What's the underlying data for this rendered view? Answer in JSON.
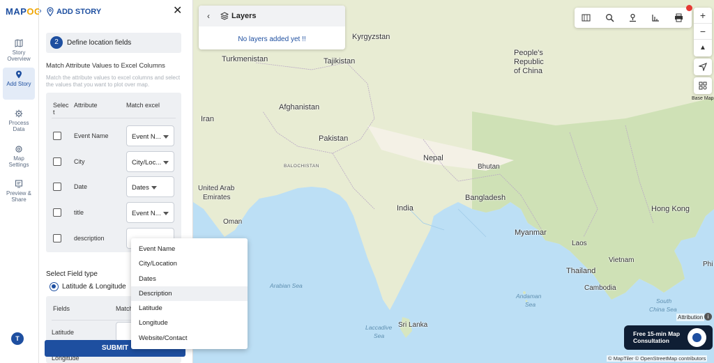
{
  "brand": {
    "logo_text_1": "MAP",
    "logo_text_2": "OG"
  },
  "rail": {
    "items": [
      {
        "label": "Story Overview"
      },
      {
        "label": "Add Story"
      },
      {
        "label": "Process Data"
      },
      {
        "label": "Map Settings"
      },
      {
        "label": "Preview & Share"
      }
    ],
    "avatar_letter": "T"
  },
  "panel": {
    "title": "ADD STORY",
    "step_number": "2",
    "step_label": "Define location fields",
    "match_title": "Match Attribute Values to Excel Columns",
    "match_desc": "Match the attribute values to excel columns and select the values that you want to plot over map.",
    "headers": {
      "select_1": "Selec",
      "select_2": "t",
      "attribute": "Attribute",
      "match": "Match excel"
    },
    "rows": [
      {
        "attribute": "Event Name",
        "value": "Event N..."
      },
      {
        "attribute": "City",
        "value": "City/Loc..."
      },
      {
        "attribute": "Date",
        "value": "Dates"
      },
      {
        "attribute": "title",
        "value": "Event N..."
      },
      {
        "attribute": "description",
        "value": ""
      }
    ],
    "field_type_label": "Select Field type",
    "field_type_option": "Latitude & Longitude",
    "fields_header": "Fields",
    "fields_match_header": "Match",
    "field_rows": [
      "Latitude",
      "Longitude"
    ],
    "submit_label": "SUBMIT"
  },
  "dropdown": {
    "options": [
      "Event Name",
      "City/Location",
      "Dates",
      "Description",
      "Latitude",
      "Longitude",
      "Website/Contact"
    ],
    "highlighted": "Description"
  },
  "layers": {
    "title": "Layers",
    "empty_message": "No layers added yet !!"
  },
  "map": {
    "places": [
      {
        "name": "Kyrgyzstan",
        "kind": "country"
      },
      {
        "name": "Tajikistan",
        "kind": "country"
      },
      {
        "name": "Turkmenistan",
        "kind": "country"
      },
      {
        "name": "People's",
        "kind": "country"
      },
      {
        "name": "Republic",
        "kind": "country"
      },
      {
        "name": "of China",
        "kind": "country"
      },
      {
        "name": "Afghanistan",
        "kind": "country"
      },
      {
        "name": "Iran",
        "kind": "country"
      },
      {
        "name": "Pakistan",
        "kind": "country"
      },
      {
        "name": "BALOCHISTAN",
        "kind": "region"
      },
      {
        "name": "Nepal",
        "kind": "country"
      },
      {
        "name": "Bhutan",
        "kind": "country"
      },
      {
        "name": "United Arab",
        "kind": "country"
      },
      {
        "name": "Emirates",
        "kind": "country"
      },
      {
        "name": "Oman",
        "kind": "country"
      },
      {
        "name": "India",
        "kind": "country"
      },
      {
        "name": "Bangladesh",
        "kind": "country"
      },
      {
        "name": "Myanmar",
        "kind": "country"
      },
      {
        "name": "Laos",
        "kind": "country"
      },
      {
        "name": "Vietnam",
        "kind": "country"
      },
      {
        "name": "Hong Kong",
        "kind": "country"
      },
      {
        "name": "Thailand",
        "kind": "country"
      },
      {
        "name": "Cambodia",
        "kind": "country"
      },
      {
        "name": "Sri Lanka",
        "kind": "country"
      },
      {
        "name": "Arabian Sea",
        "kind": "sea"
      },
      {
        "name": "Andaman",
        "kind": "sea"
      },
      {
        "name": "Sea",
        "kind": "sea"
      },
      {
        "name": "South",
        "kind": "sea"
      },
      {
        "name": "China Sea",
        "kind": "sea"
      },
      {
        "name": "Laccadive",
        "kind": "sea"
      },
      {
        "name": "Sea",
        "kind": "sea"
      },
      {
        "name": "Phi",
        "kind": "country"
      }
    ],
    "basemap_label": "Base Map",
    "attribution_label": "Attribution",
    "credit": "© MapTiler © OpenStreetMap contributors"
  },
  "consult": {
    "line1": "Free 15-min Map",
    "line2": "Consultation"
  },
  "colors": {
    "brand": "#1e4fa0",
    "accent": "#f0a500",
    "water": "#bcdff5",
    "land": "#e8ecd3"
  }
}
